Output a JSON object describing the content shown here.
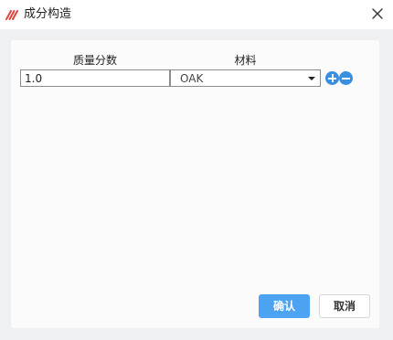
{
  "dialog": {
    "title": "成分构造",
    "icon": "app-logo-icon",
    "close_icon": "close-icon"
  },
  "table": {
    "columns": [
      "质量分数",
      "材料"
    ],
    "rows": [
      {
        "mass_fraction": "1.0",
        "material": "OAK"
      }
    ]
  },
  "actions": {
    "add_icon": "plus-icon",
    "remove_icon": "minus-icon",
    "confirm_label": "确认",
    "cancel_label": "取消"
  },
  "colors": {
    "accent": "#4ca3f2",
    "round_button": "#3b8fe0",
    "logo": "#e0443e"
  }
}
